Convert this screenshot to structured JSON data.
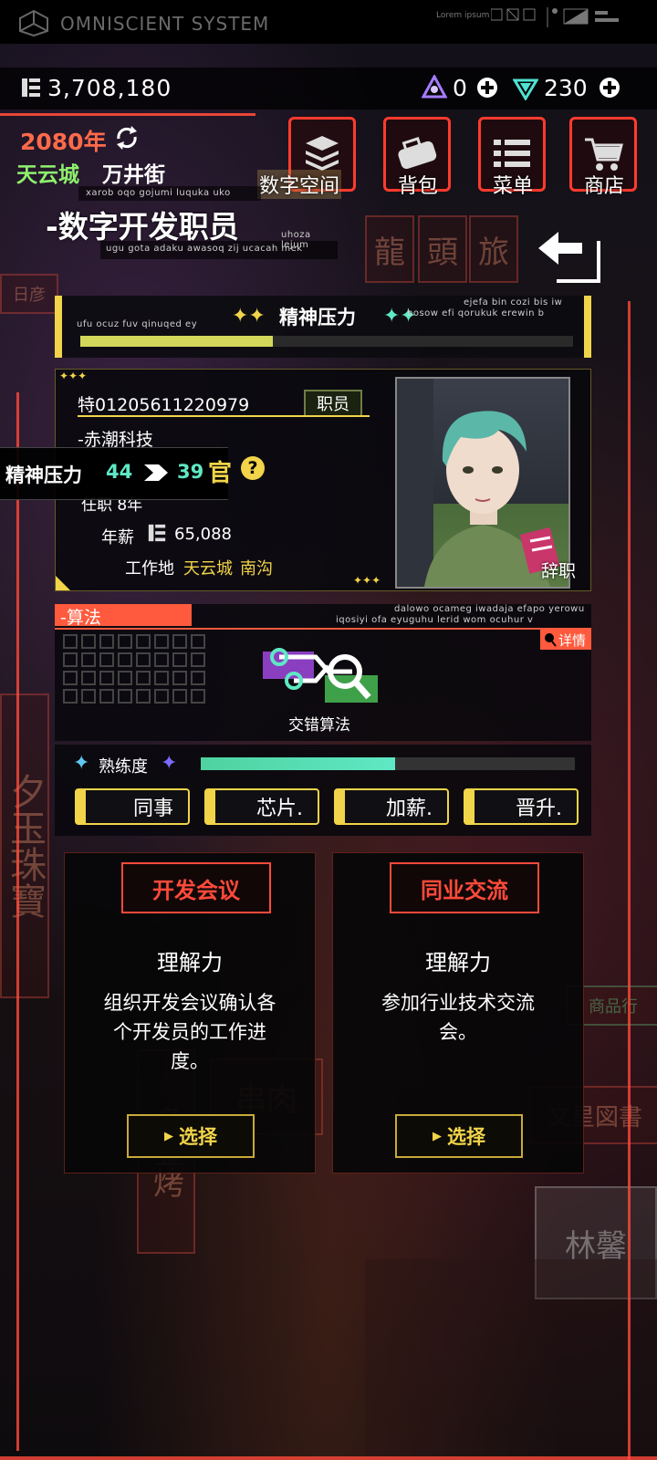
{
  "system": {
    "title": "OMNISCIENT SYSTEM",
    "lorem": "Lorem ipsum"
  },
  "resources": {
    "currency": "3,708,180",
    "gem_a": "0",
    "gem_b": "230"
  },
  "location": {
    "year": "2080年",
    "city": "天云城",
    "street": "万井街"
  },
  "nav": {
    "digital_space": "数字空间",
    "bag": "背包",
    "menu": "菜单",
    "shop": "商店"
  },
  "job": {
    "title": "-数字开发职员",
    "tag_top": "xarob oqo gojumi luquka uko",
    "tag_bottom": "ugu gota adaku awasoq zij ucacah mek",
    "tag_right": "uhoza lejum"
  },
  "stress": {
    "label": "精神压力",
    "tag_left": "ufu ocuz fuv qinuqed ey",
    "tag_right_1": "ejefa bin cozi bis iw",
    "tag_right_2": "bosow efi qorukuk erewin b",
    "fill_fraction": 0.39
  },
  "profile": {
    "id": "特01205611220979",
    "role_badge": "职员",
    "company": "-赤潮科技",
    "stress_label": "精神压力",
    "stress_from": "44",
    "stress_to": "39",
    "stress_extra": "官",
    "help": "?",
    "tenure": "任职 8年",
    "salary_label": "年薪",
    "salary_value": "65,088",
    "workplace_label": "工作地",
    "workplace_city": "天云城",
    "workplace_area": "南沟",
    "resign": "辞职"
  },
  "algorithm": {
    "header": "-算法",
    "tag_1": "dalowo ocameg iwadaja efapo yerowu",
    "tag_2": "iqosiyi ofa eyuguhu lerid wom ocuhur v",
    "detail": "详情",
    "name": "交错算法",
    "proficiency_label": "熟练度",
    "proficiency_fraction": 0.52
  },
  "tabs": [
    {
      "label": "同事"
    },
    {
      "label": "芯片."
    },
    {
      "label": "加薪."
    },
    {
      "label": "晋升."
    }
  ],
  "cards": [
    {
      "title": "开发会议",
      "attribute": "理解力",
      "desc": "组织开发会议确认各个开发员的工作进度。",
      "button": "选择"
    },
    {
      "title": "同业交流",
      "attribute": "理解力",
      "desc": "参加行业技术交流会。",
      "button": "选择"
    }
  ]
}
